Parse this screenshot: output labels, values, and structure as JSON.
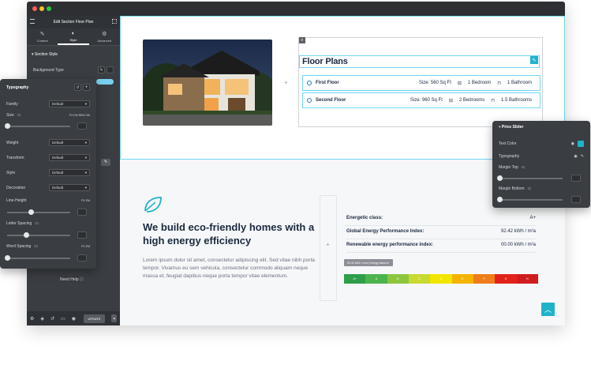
{
  "editor": {
    "title": "Edit Section Floor Plan",
    "tabs": [
      {
        "label": "Content",
        "icon": "pencil-icon"
      },
      {
        "label": "Style",
        "icon": "half-circle-icon"
      },
      {
        "label": "Advanced",
        "icon": "gear-icon"
      }
    ],
    "section_label": "Section Style",
    "background_type_label": "Background Type",
    "need_help": "Need Help",
    "update_label": "UPDATE"
  },
  "typography_panel": {
    "title": "Typography",
    "family_label": "Family",
    "family_value": "Default",
    "size_label": "Size",
    "size_units": "PX EM REM VW",
    "weight_label": "Weight",
    "weight_value": "Default",
    "transform_label": "Transform",
    "transform_value": "Default",
    "style_label": "Style",
    "style_value": "Default",
    "decoration_label": "Decoration",
    "decoration_value": "Default",
    "line_height_label": "Line-Height",
    "line_height_units": "PX EM",
    "letter_spacing_label": "Letter Spacing",
    "word_spacing_label": "Word Spacing",
    "word_spacing_units": "PX EM"
  },
  "floor_plans": {
    "title": "Floor Plans",
    "rows": [
      {
        "name": "First Floor",
        "size": "Size: 560 Sq Ft",
        "bedrooms": "1 Bedroom",
        "bathrooms": "1 Bathroom"
      },
      {
        "name": "Second Floor",
        "size": "Size: 960 Sq Ft",
        "bedrooms": "2 Bedrooms",
        "bathrooms": "1.5 Bathrooms"
      }
    ]
  },
  "eco": {
    "title": "We build eco-friendly homes with a high energy efficiency",
    "body": "Lorem ipsum dolor sit amet, consectetur adipiscing elit. Sed vitae nibh porta tempor. Vivamus eu sem vehicula, consectetur commodo aliquam neque massa et, feugiat dapibus neque porta tempor vitae elementum."
  },
  "energy": {
    "rows": [
      {
        "label": "Energetic class:",
        "value": "A+"
      },
      {
        "label": "Global Energy Performance Index:",
        "value": "92.42 kWh / m²a"
      },
      {
        "label": "Renewable energy performance index:",
        "value": "00.00 kWh / m²a"
      }
    ],
    "tooltip": "92.42 kWh / m²a | Energy class A+",
    "scale": [
      {
        "label": "A+",
        "color": "#2e9e4a"
      },
      {
        "label": "A",
        "color": "#4db34d"
      },
      {
        "label": "B",
        "color": "#8cc63f"
      },
      {
        "label": "C",
        "color": "#c8d932"
      },
      {
        "label": "D",
        "color": "#f2e600"
      },
      {
        "label": "E",
        "color": "#f5b400"
      },
      {
        "label": "F",
        "color": "#ef7d1a"
      },
      {
        "label": "G",
        "color": "#e2231a"
      },
      {
        "label": "H",
        "color": "#d01c1f"
      }
    ]
  },
  "price_slider": {
    "title": "Price Slider",
    "text_color_label": "Text Color",
    "text_color": "#1fb3c9",
    "typography_label": "Typography",
    "margin_top_label": "Margin Top",
    "margin_bottom_label": "Margin Bottom"
  },
  "colors": {
    "accent": "#71d7f7",
    "brand": "#1fb3c9",
    "dark": "#1a2a40"
  }
}
